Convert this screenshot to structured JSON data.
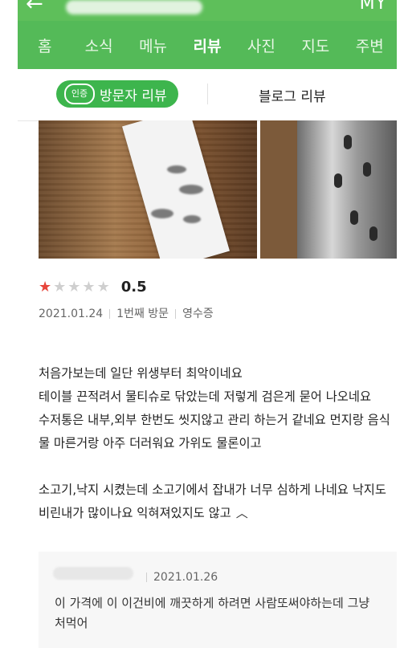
{
  "header": {
    "back_icon": "back-arrow-icon",
    "right_text": "MY"
  },
  "tabs": [
    {
      "label": "홈",
      "active": false
    },
    {
      "label": "소식",
      "active": false
    },
    {
      "label": "메뉴",
      "active": false
    },
    {
      "label": "리뷰",
      "active": true
    },
    {
      "label": "사진",
      "active": false
    },
    {
      "label": "지도",
      "active": false
    },
    {
      "label": "주변",
      "active": false
    }
  ],
  "review_tabs": {
    "verified_badge": "인증",
    "visitor_label": "방문자 리뷰",
    "blog_label": "블로그 리뷰"
  },
  "review": {
    "rating_value": "0.5",
    "rating_fraction": 0.1,
    "date": "2021.01.24",
    "visit": "1번째 방문",
    "proof": "영수증",
    "text": "처음가보는데 일단 위생부터 최악이네요\n테이블 끈적려서 물티슈로 닦았는데 저렇게 검은게 묻어 나오네요\n수저통은 내부,외부 한번도 씻지않고 관리 하는거 같네요 먼지랑 음식물 마른거랑 아주 더러워요 가위도 물론이고\n\n소고기,낙지 시켰는데 소고기에서 잡내가 너무 심하게 나네요 낙지도 비린내가 많이나요 익혀져있지도 않고",
    "collapse_icon": "chevron-up-icon"
  },
  "reply": {
    "date": "2021.01.26",
    "text": "이 가격에 이 이건비에 깨끗하게 하려면 사람또써야하는데 그냥 처먹어"
  },
  "colors": {
    "brand_green": "#54ba58",
    "pill_green": "#3db54d",
    "star_red": "#e7453b"
  }
}
